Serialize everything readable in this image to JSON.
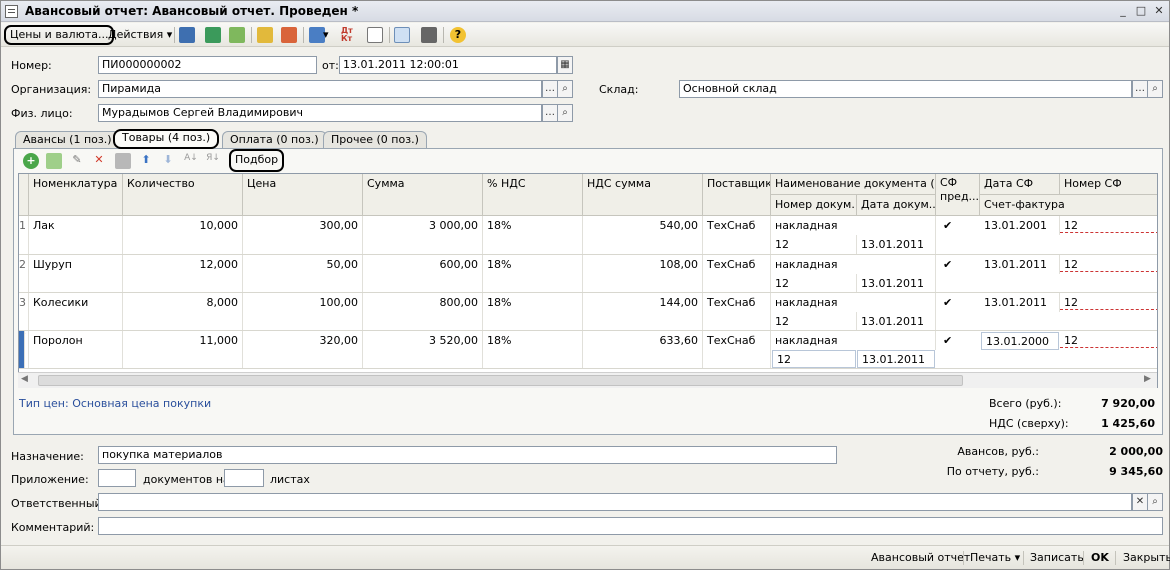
{
  "window": {
    "title": "Авансовый отчет: Авансовый отчет. Проведен *"
  },
  "toolbar": {
    "prices": "Цены и валюта...",
    "actions": "Действия"
  },
  "form": {
    "number_label": "Номер:",
    "number_value": "ПИ000000002",
    "date_label": "от:",
    "date_value": "13.01.2011 12:00:01",
    "org_label": "Организация:",
    "org_value": "Пирамида",
    "warehouse_label": "Склад:",
    "warehouse_value": "Основной склад",
    "person_label": "Физ. лицо:",
    "person_value": "Мурадымов Сергей Владимирович"
  },
  "tabs": [
    {
      "label": "Авансы (1 поз.)"
    },
    {
      "label": "Товары (4 поз.)"
    },
    {
      "label": "Оплата (0 поз.)"
    },
    {
      "label": "Прочее (0 поз.)"
    }
  ],
  "grid_toolbar": {
    "selection": "Подбор"
  },
  "grid": {
    "headers": {
      "nomenclature": "Номенклатура",
      "quantity": "Количество",
      "price": "Цена",
      "sum": "Сумма",
      "vat_rate": "% НДС",
      "vat_sum": "НДС сумма",
      "supplier": "Поставщик",
      "doc_name": "Наименование документа (р...",
      "doc_number": "Номер докум...",
      "doc_date": "Дата докум...",
      "sf": "СФ пред...",
      "sf_date": "Дата СФ",
      "sf_number": "Номер СФ",
      "invoice": "Счет-фактура"
    },
    "rows": [
      {
        "idx": "1",
        "name": "Лак",
        "qty": "10,000",
        "price": "300,00",
        "sum": "3 000,00",
        "vat": "18%",
        "vat_sum": "540,00",
        "supplier": "ТехСнаб",
        "doc": "накладная",
        "doc_no": "12",
        "doc_date": "13.01.2011",
        "sf_date": "13.01.2001",
        "sf_no": "12"
      },
      {
        "idx": "2",
        "name": "Шуруп",
        "qty": "12,000",
        "price": "50,00",
        "sum": "600,00",
        "vat": "18%",
        "vat_sum": "108,00",
        "supplier": "ТехСнаб",
        "doc": "накладная",
        "doc_no": "12",
        "doc_date": "13.01.2011",
        "sf_date": "13.01.2011",
        "sf_no": "12"
      },
      {
        "idx": "3",
        "name": "Колесики",
        "qty": "8,000",
        "price": "100,00",
        "sum": "800,00",
        "vat": "18%",
        "vat_sum": "144,00",
        "supplier": "ТехСнаб",
        "doc": "накладная",
        "doc_no": "12",
        "doc_date": "13.01.2011",
        "sf_date": "13.01.2011",
        "sf_no": "12"
      },
      {
        "idx": "4",
        "name": "Поролон",
        "qty": "11,000",
        "price": "320,00",
        "sum": "3 520,00",
        "vat": "18%",
        "vat_sum": "633,60",
        "supplier": "ТехСнаб",
        "doc": "накладная",
        "doc_no": "12",
        "doc_date": "13.01.2011",
        "sf_date": "13.01.2000",
        "sf_no": "12"
      }
    ]
  },
  "totals": {
    "price_type": "Тип цен: Основная цена покупки",
    "total_label": "Всего (руб.):",
    "total_value": "7 920,00",
    "vat_label": "НДС (сверху):",
    "vat_value": "1 425,60",
    "advance_label": "Авансов, руб.:",
    "advance_value": "2 000,00",
    "report_label": "По отчету, руб.:",
    "report_value": "9 345,60"
  },
  "bottom": {
    "purpose_label": "Назначение:",
    "purpose_value": "покупка материалов",
    "attach_label": "Приложение:",
    "docs_on": "документов на",
    "sheets": "листах",
    "responsible_label": "Ответственный:",
    "comment_label": "Комментарий:"
  },
  "statusbar": {
    "report": "Авансовый отчет",
    "print": "Печать",
    "save": "Записать",
    "ok": "OK",
    "close": "Закрыть"
  }
}
